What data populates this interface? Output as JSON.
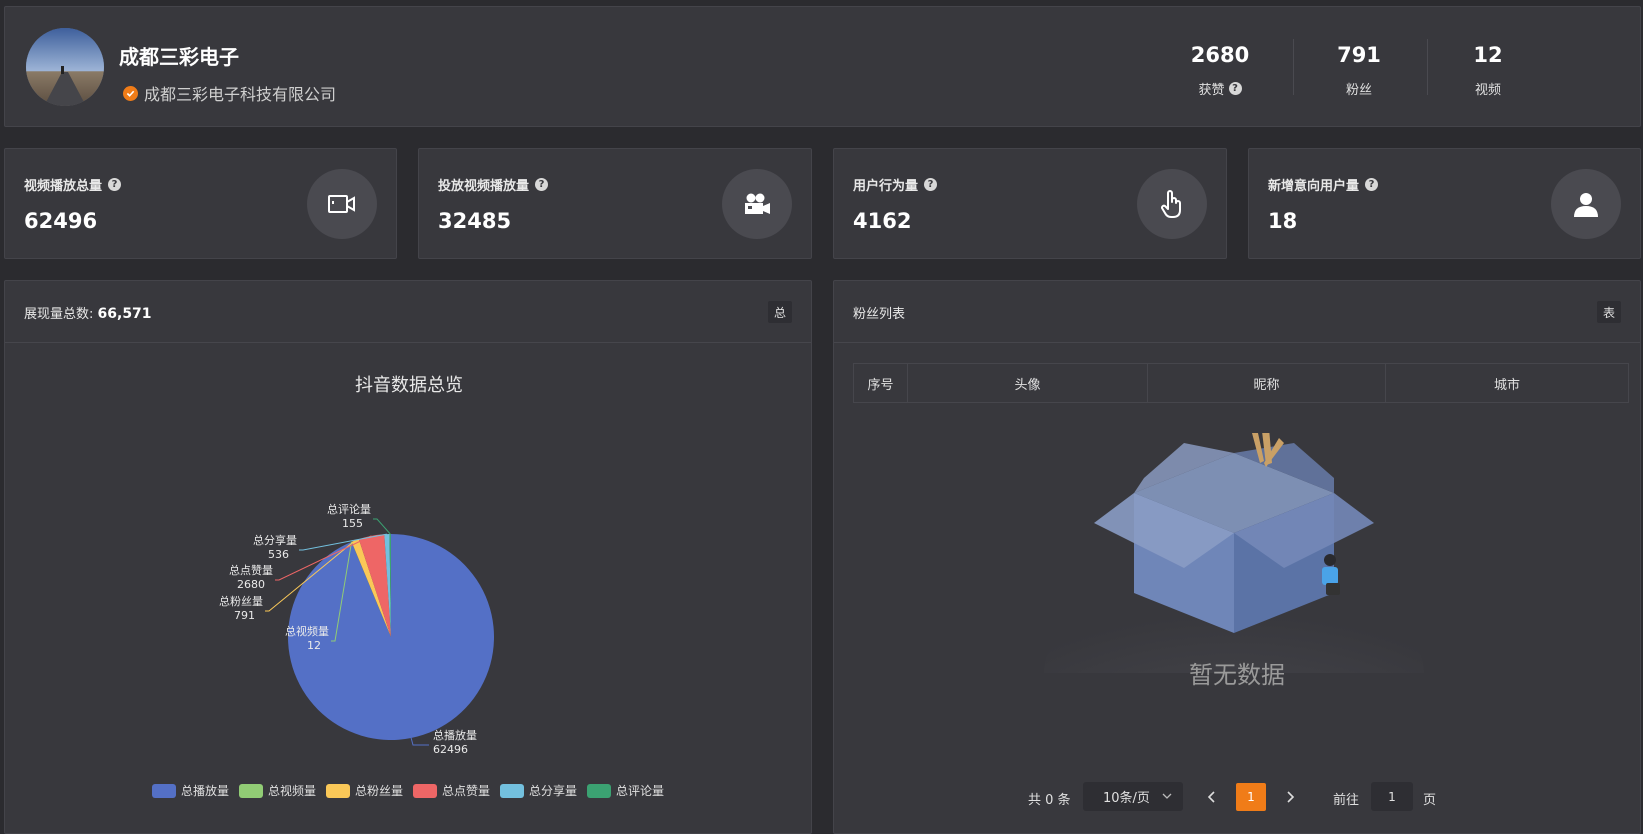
{
  "profile": {
    "name": "成都三彩电子",
    "verified_label": "成都三彩电子科技有限公司",
    "stats": [
      {
        "value": "2680",
        "label": "获赞",
        "help": true
      },
      {
        "value": "791",
        "label": "粉丝",
        "help": false
      },
      {
        "value": "12",
        "label": "视频",
        "help": false
      }
    ]
  },
  "cards": [
    {
      "title": "视频播放总量",
      "value": "62496",
      "icon": "video-camera-icon"
    },
    {
      "title": "投放视频播放量",
      "value": "32485",
      "icon": "movie-camera-icon"
    },
    {
      "title": "用户行为量",
      "value": "4162",
      "icon": "pointer-hand-icon"
    },
    {
      "title": "新增意向用户量",
      "value": "18",
      "icon": "user-icon"
    }
  ],
  "overview_panel": {
    "title_prefix": "展现量总数: ",
    "title_value": "66,571",
    "tag": "总"
  },
  "fans_panel": {
    "title": "粉丝列表",
    "tag": "表",
    "columns": [
      "序号",
      "头像",
      "昵称",
      "城市"
    ],
    "empty_text": "暂无数据",
    "pagination": {
      "total": "共 0 条",
      "page_size": "10条/页",
      "current_page": "1",
      "goto_label": "前往",
      "goto_value": "1",
      "page_suffix": "页"
    }
  },
  "colors": {
    "accent": "#f07c18",
    "panel": "#38383d",
    "background": "#2b2b2f"
  },
  "chart_data": {
    "type": "pie",
    "title": "抖音数据总览",
    "slices": [
      {
        "name": "总播放量",
        "value": 62496,
        "color": "#5470c6"
      },
      {
        "name": "总视频量",
        "value": 12,
        "color": "#91cc75"
      },
      {
        "name": "总粉丝量",
        "value": 791,
        "color": "#fac858"
      },
      {
        "name": "总点赞量",
        "value": 2680,
        "color": "#ee6666"
      },
      {
        "name": "总分享量",
        "value": 536,
        "color": "#73c0de"
      },
      {
        "name": "总评论量",
        "value": 155,
        "color": "#3ba272"
      }
    ],
    "legend_position": "bottom"
  }
}
